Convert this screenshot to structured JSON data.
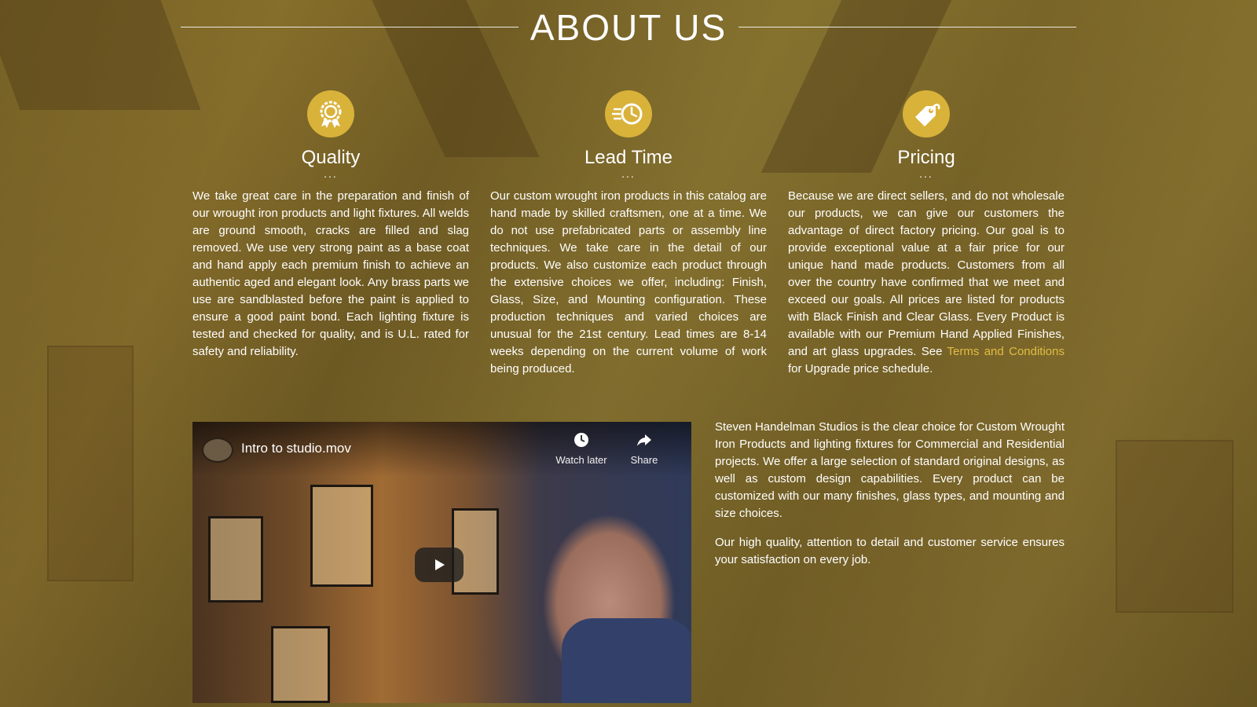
{
  "page": {
    "title": "ABOUT US"
  },
  "features": [
    {
      "icon": "quality-badge-icon",
      "heading": "Quality",
      "dots": "...",
      "body": "We take great care in the preparation and finish of our wrought iron products and light fixtures. All welds are ground smooth, cracks are filled and slag removed. We use very strong paint as a base coat and hand apply each premium finish to achieve an authentic aged and elegant look. Any brass parts we use are sandblasted before the paint is applied to ensure a good paint bond. Each lighting fixture is tested and checked for quality, and is U.L. rated for safety and reliability."
    },
    {
      "icon": "fast-clock-icon",
      "heading": "Lead Time",
      "dots": "...",
      "body": "Our custom wrought iron products in this catalog are hand made by skilled craftsmen, one at a time. We do not use prefabricated parts or assembly line techniques. We take care in the detail of our products. We also customize each product through the extensive choices we offer, including: Finish, Glass, Size, and Mounting configuration. These production techniques and varied choices are unusual for the 21st century. Lead times are 8-14 weeks depending on the current volume of work being produced."
    },
    {
      "icon": "price-tag-icon",
      "heading": "Pricing",
      "dots": "...",
      "body_before": "Because we are direct sellers, and do not wholesale our products, we can give our customers the advantage of direct factory pricing. Our goal is to provide exceptional value at a fair price for our unique hand made products. Customers from all over the country have confirmed that we meet and exceed our goals. All prices are listed for products with Black Finish and Clear Glass. Every Product is available with our Premium Hand Applied Finishes, and art glass upgrades. See ",
      "link_text": "Terms and Conditions",
      "body_after": " for Upgrade price schedule."
    }
  ],
  "video": {
    "title": "Intro to studio.mov",
    "watch_later_label": "Watch later",
    "share_label": "Share",
    "icons": [
      "clock-icon",
      "share-arrow-icon",
      "play-icon"
    ]
  },
  "about": {
    "paragraph1": "Steven Handelman Studios is the clear choice for Custom Wrought Iron Products and lighting fixtures for Commercial and Residential projects. We offer a large selection of standard original designs, as well as custom design capabilities. Every product can be customized with our many finishes, glass types, and mounting and size choices.",
    "paragraph2": "Our high quality, attention to detail and customer service ensures your satisfaction on every job."
  },
  "colors": {
    "accent": "#d9b23a",
    "link": "#e2bd43",
    "text": "#ffffff"
  }
}
